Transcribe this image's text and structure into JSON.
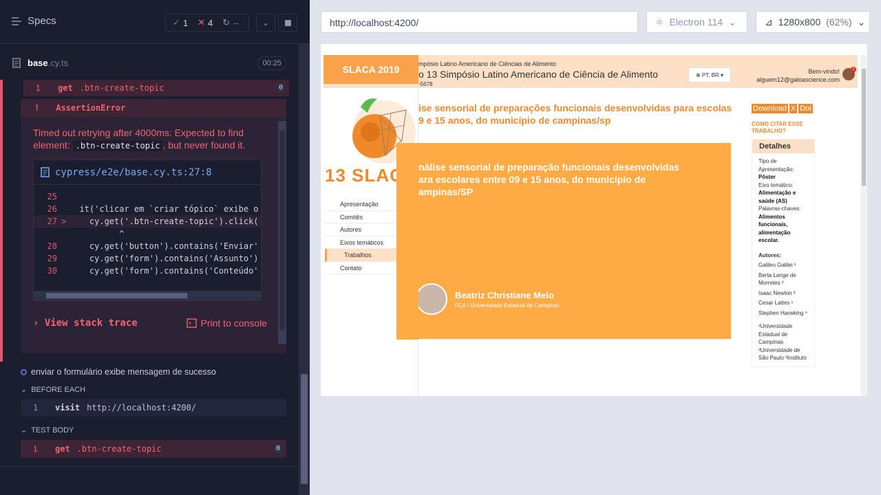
{
  "runner": {
    "specs_label": "Specs",
    "stats": {
      "passed": "1",
      "failed": "4",
      "pending": "--"
    },
    "file": {
      "name": "base",
      "ext": ".cy.ts",
      "duration": "00:25"
    },
    "failed_command": {
      "num": "1",
      "name": "get",
      "arg": ".btn-create-topic",
      "badge": "0"
    },
    "error": {
      "icon": "!",
      "type": "AssertionError",
      "message_pre": "Timed out retrying after 4000ms: Expected to find element:",
      "message_code": ".btn-create-topic",
      "message_post": ", but never found it.",
      "file_link": "cypress/e2e/base.cy.ts:27:8",
      "code_lines": [
        {
          "n": "25",
          "marker": "",
          "text": ""
        },
        {
          "n": "26",
          "marker": "",
          "text": "  it('clicar em `criar tópico` exibe o"
        },
        {
          "n": "27",
          "marker": ">",
          "text": "    cy.get('.btn-create-topic').click("
        },
        {
          "n": "",
          "marker": "",
          "text": "          ^"
        },
        {
          "n": "28",
          "marker": "",
          "text": "    cy.get('button').contains('Enviar'"
        },
        {
          "n": "29",
          "marker": "",
          "text": "    cy.get('form').contains('Assunto')"
        },
        {
          "n": "30",
          "marker": "",
          "text": "    cy.get('form').contains('Conteúdo'"
        }
      ],
      "view_stack": "View stack trace",
      "print_console": "Print to console"
    },
    "next_test": "enviar o formulário exibe mensagem de sucesso",
    "before_each": "BEFORE EACH",
    "visit": {
      "num": "1",
      "name": "visit",
      "arg": "http://localhost:4200/"
    },
    "test_body": "TEST BODY",
    "body_cmd": {
      "num": "1",
      "name": "get",
      "arg": ".btn-create-topic",
      "badge": "0"
    }
  },
  "browser": {
    "url": "http://localhost:4200/",
    "engine": "Electron 114",
    "viewport": "1280x800",
    "zoom": "(62%)"
  },
  "aut": {
    "logo": "SLACA 2019",
    "header_small": "mpósio Latino Americano de Ciências de Alimento",
    "header_big": "o 13 Simpósio Latino Americano de Ciência de Alimento",
    "header_id": "-5678",
    "lang": "PT, BR",
    "welcome_1": "Bem-vindo!",
    "welcome_2": "alguem12@galoascience.com",
    "notif": "2",
    "slaca_text": "13 SLACA",
    "nav": [
      "Apresentação",
      "Comitês",
      "Autores",
      "Eixos temáticos",
      "Trabalhos",
      "Contato"
    ],
    "paper_title": "ise sensorial de preparações funcionais desenvolvidas para escolas 9 e 15 anos, do município de campinas/sp",
    "poster_title": "nálise sensorial de preparação funcionais desenvolvidas ara escolares entre 09 e 15 anos, do município de ampinas/SP",
    "author_name": "Beatriz Christiane Melo",
    "author_inst": "FCA / Universidade Estadual de Campinas",
    "btn_download": "Download",
    "btn_x": "X",
    "btn_doi": "Doi",
    "cite": "COMO CITAR ESSE TRABALHO?",
    "details": {
      "title": "Detalhes",
      "type_label": "Tipo de Apresentação:",
      "type_value": "Pôster",
      "axis_label": "Eixo temático:",
      "axis_value": "Alimentação e saúde (AS)",
      "kw_label": "Palavras-chaves:",
      "kw_value": "Alimentos funcionais, alimentação escolar.",
      "authors_label": "Autores:",
      "authors": [
        "Galileo Galilei ¹",
        "Berta Lange de Morretes ²",
        "Isaac Newton ³",
        "Cesar Lattes ¹",
        "Stephen Harwking ⁴"
      ],
      "affil": "¹Universidade Estadual de Campinas ²Universidade de São Paulo ³Instituto"
    }
  },
  "colors": {
    "fail": "#f06470",
    "pass": "#1fa971",
    "aut_orange": "#ffab45"
  }
}
